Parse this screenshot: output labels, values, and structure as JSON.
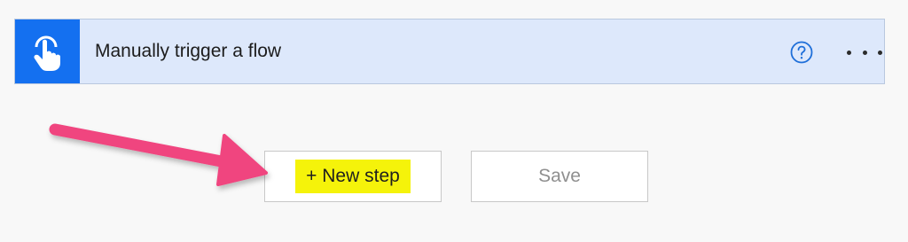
{
  "trigger": {
    "title": "Manually trigger a flow",
    "icon": "touch-hand-icon",
    "help_icon": "help-circle-icon",
    "more_icon": "ellipsis-icon"
  },
  "actions": {
    "new_step_label": "+ New step",
    "save_label": "Save"
  },
  "colors": {
    "trigger_icon_bg": "#1470f0",
    "trigger_card_bg": "#dde8fb",
    "highlight": "#f5f30a",
    "annotation_arrow": "#f0457f"
  }
}
